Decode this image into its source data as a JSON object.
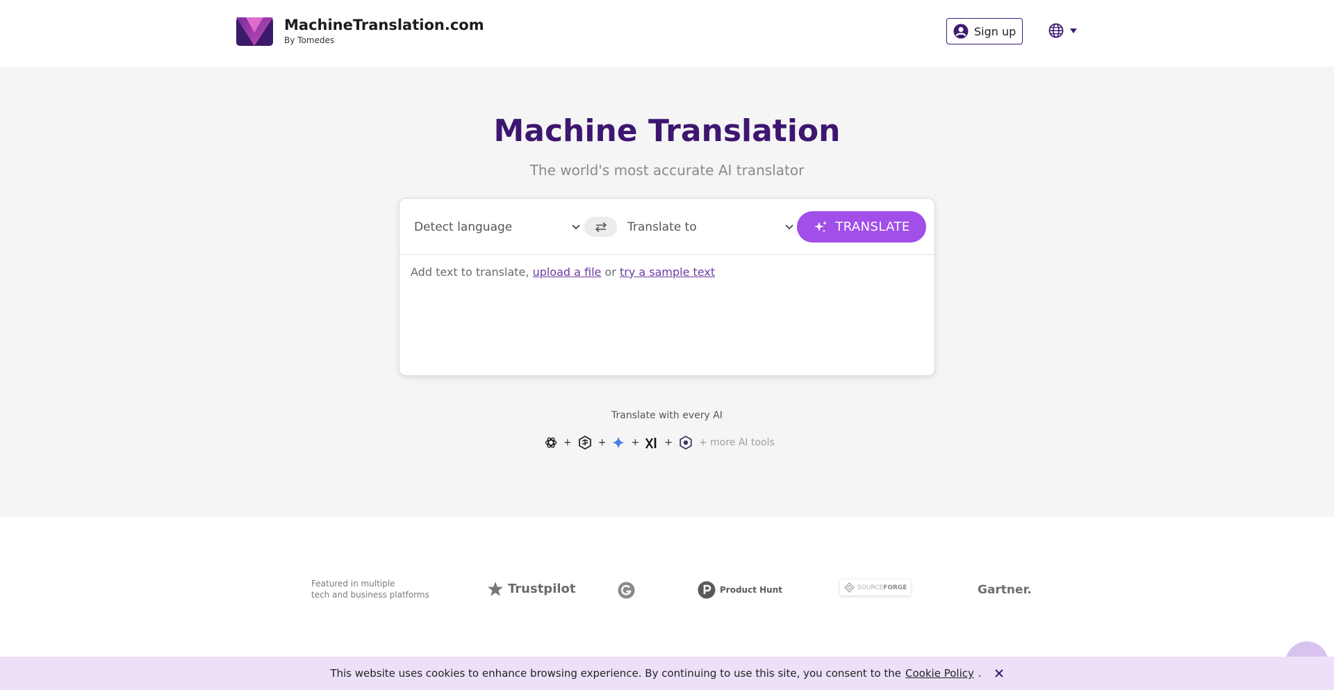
{
  "header": {
    "brand_name": "MachineTranslation.com",
    "brand_sub": "By Tomedes",
    "signup_label": "Sign up"
  },
  "hero": {
    "title": "Machine Translation",
    "subtitle": "The world's most accurate AI translator"
  },
  "translator": {
    "source_language": "Detect language",
    "target_language": "Translate to",
    "translate_label": "TRANSLATE",
    "prompt_prefix": "Add text to translate,",
    "upload_link": "upload a file",
    "or_text": "or",
    "sample_link": "try a sample text"
  },
  "ai_tools": {
    "heading": "Translate with every AI",
    "icons": [
      "openai-icon",
      "perplexity-icon",
      "gemini-icon",
      "grok-icon",
      "ai-model-icon"
    ],
    "plus": "+",
    "more": "+ more AI tools"
  },
  "featured": {
    "line1": "Featured in multiple",
    "line2": "tech and business platforms",
    "platforms": {
      "trustpilot": "Trustpilot",
      "producthunt": "Product Hunt",
      "sourceforge_a": "SOURCE",
      "sourceforge_b": "FORGE",
      "gartner": "Gartner."
    }
  },
  "cookie": {
    "text": "This website uses cookies to enhance browsing experience. By continuing to use this site, you consent to the",
    "policy_link": "Cookie Policy",
    "period": "."
  },
  "colors": {
    "brand_purple": "#3d1670",
    "button_purple": "#a14fe8",
    "hero_bg": "#f5f5f5",
    "cookie_bg": "#ece1f8"
  }
}
